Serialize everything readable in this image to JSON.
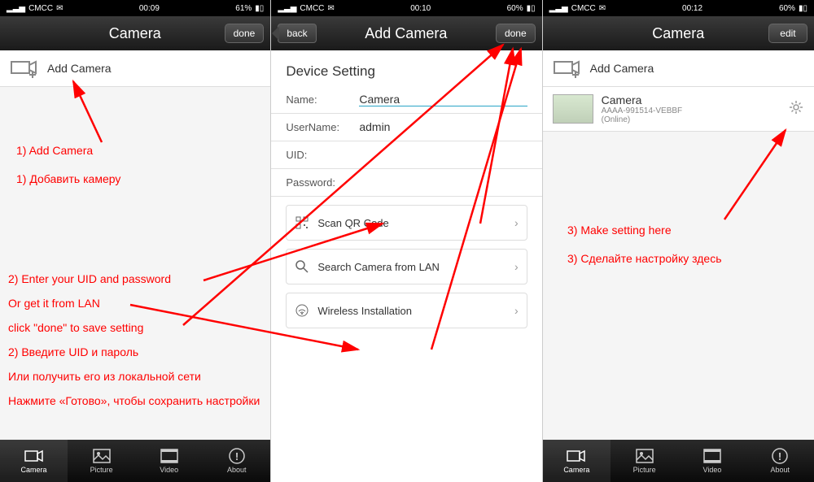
{
  "screen1": {
    "status": {
      "carrier": "CMCC",
      "time": "00:09",
      "battery": "61%"
    },
    "header": {
      "title": "Camera",
      "done": "done"
    },
    "addCamera": "Add Camera",
    "tabs": {
      "camera": "Camera",
      "picture": "Picture",
      "video": "Video",
      "about": "About"
    }
  },
  "screen2": {
    "status": {
      "carrier": "CMCC",
      "time": "00:10",
      "battery": "60%"
    },
    "header": {
      "back": "back",
      "title": "Add Camera",
      "done": "done"
    },
    "sectionTitle": "Device Setting",
    "fields": {
      "nameLabel": "Name:",
      "nameVal": "Camera",
      "userLabel": "UserName:",
      "userVal": "admin",
      "uidLabel": "UID:",
      "uidVal": "",
      "pwdLabel": "Password:",
      "pwdVal": ""
    },
    "options": {
      "scan": "Scan QR Code",
      "lan": "Search Camera from LAN",
      "wireless": "Wireless Installation"
    }
  },
  "screen3": {
    "status": {
      "carrier": "CMCC",
      "time": "00:12",
      "battery": "60%"
    },
    "header": {
      "title": "Camera",
      "edit": "edit"
    },
    "addCamera": "Add Camera",
    "cam": {
      "name": "Camera",
      "uid": "AAAA-991514-VEBBF",
      "status": "(Online)"
    },
    "tabs": {
      "camera": "Camera",
      "picture": "Picture",
      "video": "Video",
      "about": "About"
    }
  },
  "annotations": {
    "a1": "1) Add Camera",
    "a1ru": "1) Добавить камеру",
    "a2": "2) Enter your UID and password",
    "a2b": "Or get it from LAN",
    "a2c": "click \"done\" to save setting",
    "a2ru": "2) Введите UID и пароль",
    "a2bru": "Или получить его из локальной сети",
    "a2cru": "Нажмите «Готово», чтобы сохранить настройки",
    "a3": "3) Make setting here",
    "a3ru": "3) Сделайте настройку здесь"
  }
}
